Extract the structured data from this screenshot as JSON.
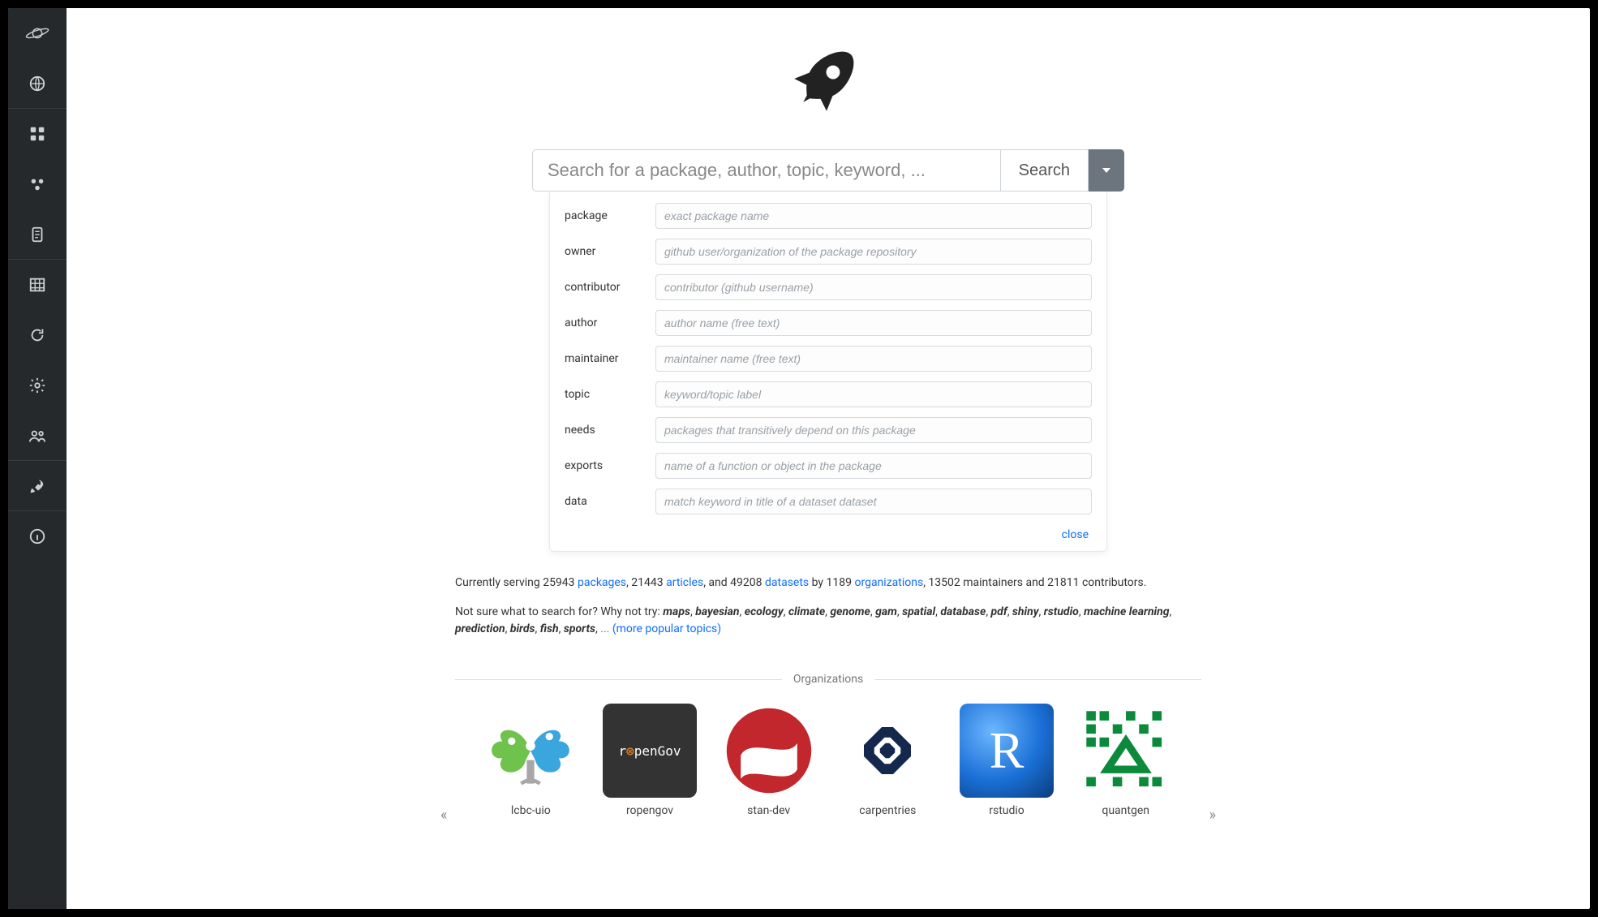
{
  "search": {
    "placeholder": "Search for a package, author, topic, keyword, ...",
    "button": "Search"
  },
  "advanced": {
    "fields": [
      {
        "label": "package",
        "placeholder": "exact package name"
      },
      {
        "label": "owner",
        "placeholder": "github user/organization of the package repository"
      },
      {
        "label": "contributor",
        "placeholder": "contributor (github username)"
      },
      {
        "label": "author",
        "placeholder": "author name (free text)"
      },
      {
        "label": "maintainer",
        "placeholder": "maintainer name (free text)"
      },
      {
        "label": "topic",
        "placeholder": "keyword/topic label"
      },
      {
        "label": "needs",
        "placeholder": "packages that transitively depend on this package"
      },
      {
        "label": "exports",
        "placeholder": "name of a function or object in the package"
      },
      {
        "label": "data",
        "placeholder": "match keyword in title of a dataset dataset"
      }
    ],
    "close": "close"
  },
  "stats": {
    "prefix": "Currently serving ",
    "packages_n": "25943",
    "packages": "packages",
    "articles_n": "21443",
    "articles": "articles",
    "datasets_mid": ", and ",
    "datasets_n": "49208",
    "datasets": "datasets",
    "by": " by ",
    "orgs_n": "1189",
    "orgs": "organizations",
    "tail": ", 13502 maintainers and 21811 contributors."
  },
  "topics": {
    "lead": "Not sure what to search for? Why not try: ",
    "list": [
      "maps",
      "bayesian",
      "ecology",
      "climate",
      "genome",
      "gam",
      "spatial",
      "database",
      "pdf",
      "shiny",
      "rstudio",
      "machine learning",
      "prediction",
      "birds",
      "fish",
      "sports"
    ],
    "more": "... (more popular topics)"
  },
  "orgs_title": "Organizations",
  "orgs": [
    {
      "name": "lcbc-uio"
    },
    {
      "name": "ropengov"
    },
    {
      "name": "stan-dev"
    },
    {
      "name": "carpentries"
    },
    {
      "name": "rstudio"
    },
    {
      "name": "quantgen"
    }
  ],
  "ropengov_text": {
    "r": "r",
    "paren": "⊗",
    "rest": "penGov"
  },
  "rstudio_letter": "R"
}
